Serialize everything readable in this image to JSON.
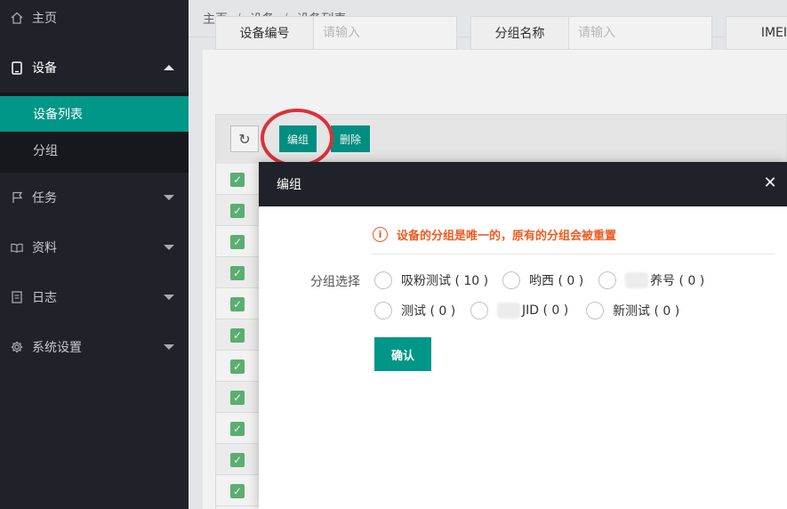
{
  "sidebar": {
    "items": [
      {
        "label": "主页",
        "icon": "home-icon"
      },
      {
        "label": "设备",
        "icon": "tablet-icon"
      },
      {
        "label": "任务",
        "icon": "flag-icon"
      },
      {
        "label": "资料",
        "icon": "book-icon"
      },
      {
        "label": "日志",
        "icon": "document-icon"
      },
      {
        "label": "系统设置",
        "icon": "gear-icon"
      }
    ],
    "sub_items": [
      {
        "label": "设备列表"
      },
      {
        "label": "分组"
      }
    ]
  },
  "breadcrumb": [
    "主页",
    "设备",
    "设备列表"
  ],
  "breadcrumb_sep": "/",
  "search": {
    "fields": [
      {
        "label": "设备编号",
        "placeholder": "请输入"
      },
      {
        "label": "分组名称",
        "placeholder": "请输入"
      },
      {
        "label": "IMEI",
        "placeholder": ""
      }
    ]
  },
  "toolbar": {
    "refresh_icon": "↻",
    "group_edit_label": "编组",
    "delete_label": "删除"
  },
  "rows": [
    {
      "checked": true
    },
    {
      "checked": true
    },
    {
      "checked": true
    },
    {
      "checked": true
    },
    {
      "checked": true
    },
    {
      "checked": true
    },
    {
      "checked": true
    },
    {
      "checked": true
    },
    {
      "checked": true
    },
    {
      "checked": true
    },
    {
      "checked": true
    }
  ],
  "dialog": {
    "title": "编组",
    "close_icon": "✕",
    "warning": "设备的分组是唯一的，原有的分组会被重置",
    "warning_icon": "i",
    "group_label": "分组选择",
    "options": [
      {
        "label": "吸粉测试 ( 10 )"
      },
      {
        "label": "哟西 ( 0 )"
      },
      {
        "label": "养号 ( 0 )"
      },
      {
        "label": "测试 ( 0 )"
      },
      {
        "label": "JID ( 0 )"
      },
      {
        "label": "新测试 ( 0 )"
      }
    ],
    "confirm_label": "确认"
  },
  "colors": {
    "accent": "#009688",
    "sidebar_bg": "#20222a",
    "warning": "#f15a22",
    "highlight_circle": "#e8333f",
    "checkbox": "#5fb878"
  }
}
